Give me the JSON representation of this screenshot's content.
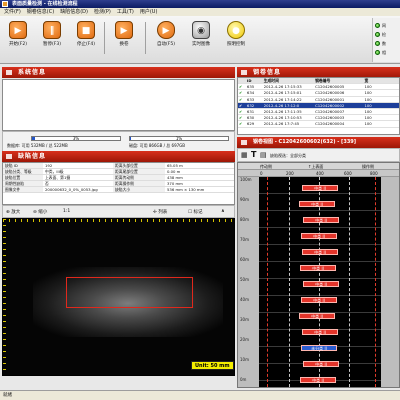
{
  "window": {
    "title": "表面质量检测 - 在线检测流程"
  },
  "menu": [
    "文件(F)",
    "钢卷信息(C)",
    "缺陷信息(D)",
    "检测(P)",
    "工具(T)",
    "用户(U)"
  ],
  "toolbar": [
    {
      "label": "开始(F2)",
      "glyph": "▶"
    },
    {
      "label": "暂停(F3)",
      "glyph": "‖"
    },
    {
      "label": "停止(F4)",
      "glyph": "■"
    },
    {
      "label": "换卷",
      "glyph": "▶"
    },
    {
      "label": "自动(F5)",
      "glyph": "▶"
    },
    {
      "label": "实时图像",
      "glyph": "◉"
    },
    {
      "label": "照明控制",
      "glyph": "●"
    }
  ],
  "status_leds": [
    "网",
    "检",
    "数",
    "相"
  ],
  "system_panel": {
    "title": "系统信息",
    "data_label": "数据库: 可用 532MB / 总 522MB",
    "data_pct": "3%",
    "data_fill": 0.03,
    "disk_label": "磁盘: 可用 866GB / 总 697GB",
    "disk_pct": "1%",
    "disk_fill": 0.01
  },
  "defect_panel": {
    "title": "缺陷信息",
    "rows": [
      [
        "缺陷 ID",
        "192",
        "距离头部位置",
        "65.05 m"
      ],
      [
        "缺陷分类、等级",
        "中类，III级",
        "距离尾部位置",
        "0.00 m"
      ],
      [
        "缺陷位置",
        "上表面、第1摄",
        "距离传动侧",
        "438 mm"
      ],
      [
        "周期性缺陷",
        "否",
        "距离操作侧",
        "370 mm"
      ],
      [
        "图像文件",
        "200000632_0_0%_0053.jpg",
        "缺陷大小",
        "536 mm × 130 mm"
      ]
    ]
  },
  "image_tools": {
    "zoom_in": "放大",
    "zoom_out": "缩小",
    "ratio": "1:1",
    "list": "列表",
    "mark": "标记"
  },
  "image": {
    "unit_label": "Unit: 50 mm"
  },
  "coil_panel": {
    "title": "钢卷信息",
    "columns": [
      "",
      "ID",
      "生成时间",
      "钢卷编号",
      "宽"
    ],
    "rows": [
      {
        "id": "635",
        "time": "2012-4-26 17:15:33",
        "no": "C12042600005",
        "w": "100"
      },
      {
        "id": "634",
        "time": "2012-4-26 17:15:01",
        "no": "C12042600006",
        "w": "100"
      },
      {
        "id": "633",
        "time": "2012-4-26 17:14:22",
        "no": "C12042600001",
        "w": "100"
      },
      {
        "id": "632",
        "time": "2012-4-26 17:12:0",
        "no": "C12042600002",
        "w": "100"
      },
      {
        "id": "631",
        "time": "2012-4-26 17:11:35",
        "no": "C12042600007",
        "w": "100"
      },
      {
        "id": "630",
        "time": "2012-4-26 17:10:53",
        "no": "C12042600003",
        "w": "100"
      },
      {
        "id": "629",
        "time": "2012-4-26 17:7:45",
        "no": "C12042600004",
        "w": "100"
      }
    ]
  },
  "coil_map": {
    "title": "钢卷视图 - C12042600602(632) - [339]",
    "filter": "缺陷视选：全部分类",
    "col_left": "传动侧",
    "col_center": "上表面",
    "col_right": "操作侧",
    "scale": [
      "0",
      "200",
      "400",
      "600",
      "800"
    ],
    "rows": [
      "100m",
      "90m",
      "80m",
      "70m",
      "60m",
      "50m",
      "40m",
      "30m",
      "20m",
      "10m",
      "0m"
    ],
    "chips": [
      {
        "label": "中类 II",
        "color": "red"
      },
      {
        "label": "中类 II",
        "color": "red"
      },
      {
        "label": "中类 II",
        "color": "red"
      },
      {
        "label": "中类 II",
        "color": "red"
      },
      {
        "label": "中类 II",
        "color": "red"
      },
      {
        "label": "中类 II",
        "color": "red"
      },
      {
        "label": "中类 II",
        "color": "red"
      },
      {
        "label": "中类 II",
        "color": "red"
      },
      {
        "label": "中类 II",
        "color": "red"
      },
      {
        "label": "中类 II",
        "color": "red"
      },
      {
        "label": "未分类 II",
        "color": "blue"
      },
      {
        "label": "中类 II",
        "color": "red"
      },
      {
        "label": "中类 II",
        "color": "red"
      }
    ]
  },
  "status_bar": "就绪"
}
